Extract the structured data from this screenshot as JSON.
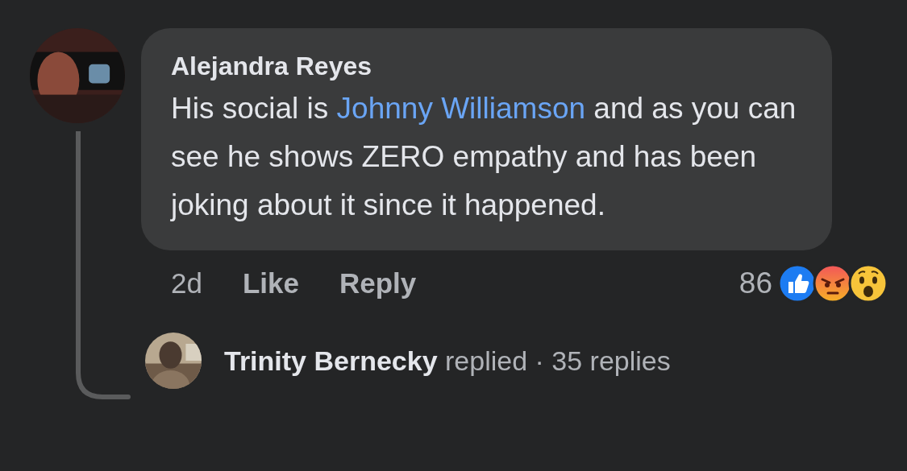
{
  "comment": {
    "author": "Alejandra Reyes",
    "text_before": "His social is ",
    "link": "Johnny Williamson",
    "text_after": " and as you can see he shows ZERO empathy and has been joking about it since it happened.",
    "time": "2d",
    "actions": [
      "Like",
      "Reply"
    ],
    "reaction_count": "86",
    "reactions": [
      {
        "kind": "like"
      },
      {
        "kind": "angry"
      },
      {
        "kind": "wow"
      }
    ]
  },
  "replies_summary": {
    "name": "Trinity Bernecky",
    "verb": "replied",
    "separator": "·",
    "count": "35 replies"
  }
}
